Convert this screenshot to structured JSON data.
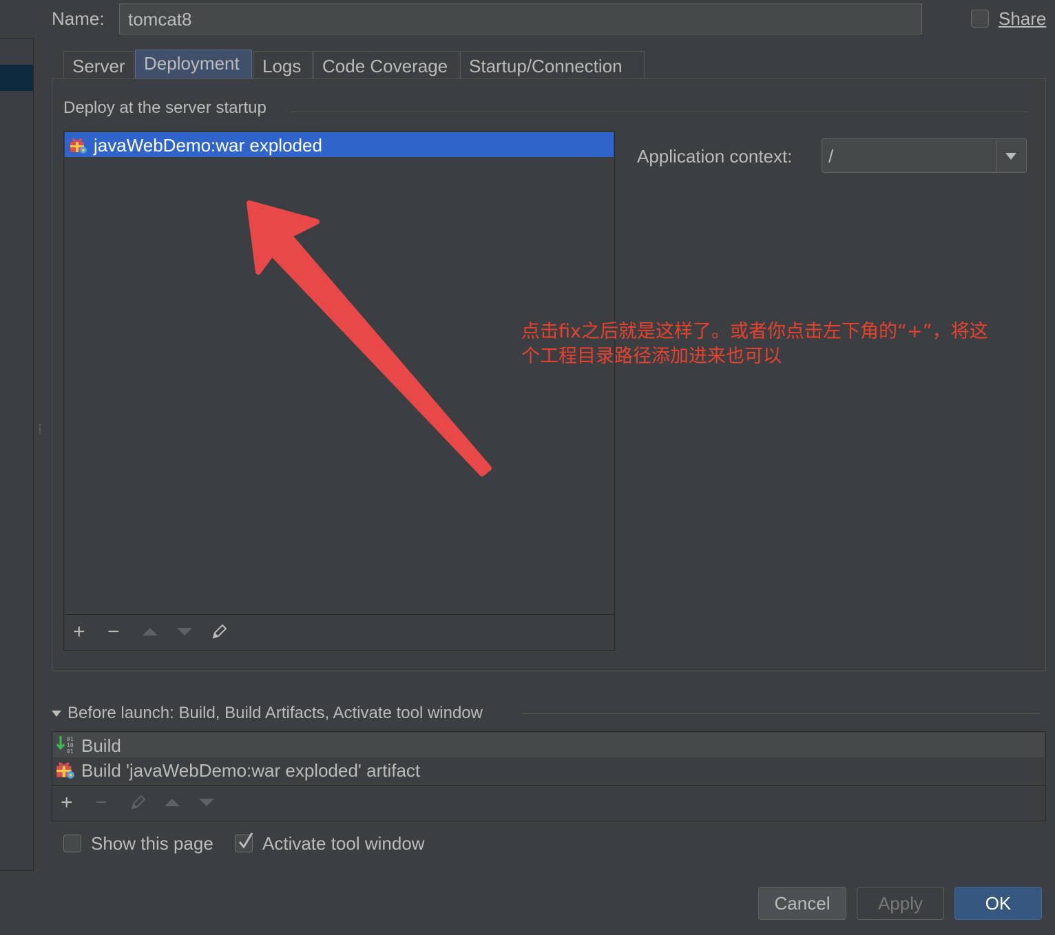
{
  "name": {
    "label": "Name:",
    "value": "tomcat8"
  },
  "share": {
    "label": "Share",
    "checked": false
  },
  "tabs": [
    {
      "label": "Server"
    },
    {
      "label": "Deployment",
      "selected": true
    },
    {
      "label": "Logs"
    },
    {
      "label": "Code Coverage"
    },
    {
      "label": "Startup/Connection"
    }
  ],
  "deploy": {
    "section_title": "Deploy at the server startup",
    "items": [
      {
        "label": "javaWebDemo:war exploded",
        "icon": "artifact-icon"
      }
    ],
    "toolbar": {
      "add": "+",
      "remove": "−"
    }
  },
  "context": {
    "label": "Application context:",
    "value": "/"
  },
  "annotation": "点击fix之后就是这样了。或者你点击左下角的“+”，将这个工程目录路径添加进来也可以",
  "before_launch": {
    "title": "Before launch: Build, Build Artifacts, Activate tool window",
    "items": [
      {
        "label": "Build",
        "icon": "build-icon"
      },
      {
        "label": "Build 'javaWebDemo:war exploded' artifact",
        "icon": "artifact-icon"
      }
    ],
    "toolbar": {
      "add": "+",
      "remove": "−"
    }
  },
  "options": {
    "show_page": {
      "label": "Show this page",
      "checked": false
    },
    "activate_tool": {
      "label": "Activate tool window",
      "checked": true
    }
  },
  "buttons": {
    "cancel": "Cancel",
    "apply": "Apply",
    "ok": "OK"
  },
  "colors": {
    "accent": "#2f65ca",
    "annotation": "#e8412e",
    "arrow": "#e84848"
  }
}
